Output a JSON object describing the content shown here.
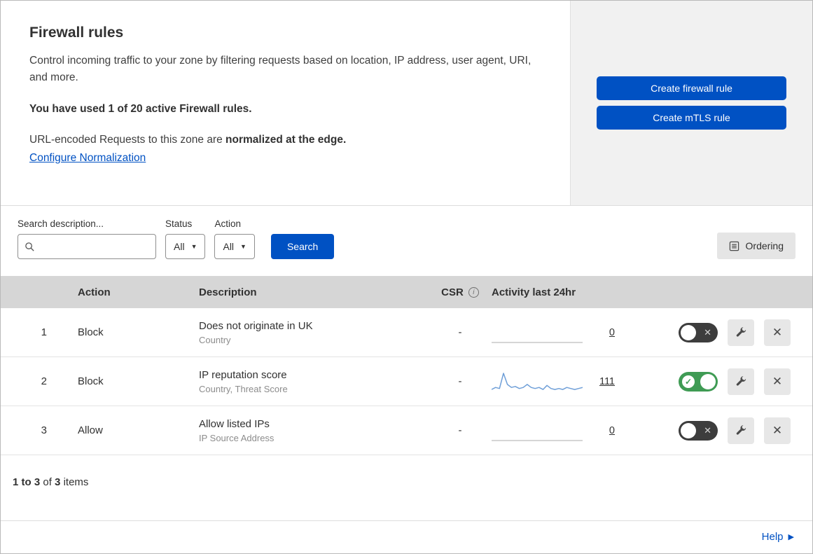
{
  "header": {
    "title": "Firewall rules",
    "description": "Control incoming traffic to your zone by filtering requests based on location, IP address, user agent, URI, and more.",
    "usage": "You have used 1 of 20 active Firewall rules.",
    "normalization_text": "URL-encoded Requests to this zone are ",
    "normalization_bold": "normalized at the edge.",
    "configure_link": "Configure Normalization",
    "buttons": {
      "create_firewall": "Create firewall rule",
      "create_mtls": "Create mTLS rule"
    }
  },
  "filters": {
    "search_label": "Search description...",
    "status_label": "Status",
    "status_value": "All",
    "action_label": "Action",
    "action_value": "All",
    "search_button": "Search",
    "ordering_button": "Ordering"
  },
  "table": {
    "columns": {
      "action": "Action",
      "description": "Description",
      "csr": "CSR",
      "activity": "Activity last 24hr"
    },
    "rows": [
      {
        "index": "1",
        "action": "Block",
        "description": "Does not originate in UK",
        "fields": "Country",
        "csr": "-",
        "activity_count": "0",
        "enabled": false,
        "spark": [
          0,
          0,
          0,
          0,
          0,
          0,
          0,
          0,
          0,
          0,
          0,
          0,
          0,
          0,
          0,
          0,
          0,
          0,
          0,
          0,
          0,
          0,
          0,
          0
        ]
      },
      {
        "index": "2",
        "action": "Block",
        "description": "IP reputation score",
        "fields": "Country, Threat Score",
        "csr": "-",
        "activity_count": "111",
        "enabled": true,
        "spark": [
          1,
          2,
          1.5,
          9,
          3.5,
          2,
          2.5,
          1.5,
          2,
          3.5,
          2,
          1.5,
          2,
          1,
          3,
          1.5,
          1,
          1.5,
          1,
          2,
          1.5,
          1,
          1.5,
          2
        ]
      },
      {
        "index": "3",
        "action": "Allow",
        "description": "Allow listed IPs",
        "fields": "IP Source Address",
        "csr": "-",
        "activity_count": "0",
        "enabled": false,
        "spark": [
          0,
          0,
          0,
          0,
          0,
          0,
          0,
          0,
          0,
          0,
          0,
          0,
          0,
          0,
          0,
          0,
          0,
          0,
          0,
          0,
          0,
          0,
          0,
          0
        ]
      }
    ],
    "footer": {
      "range": "1 to 3",
      "of_word": "of",
      "total": "3",
      "items_word": "items"
    }
  },
  "help_link": "Help",
  "colors": {
    "accent_blue": "#0051c3",
    "toggle_on_green": "#3f9b54",
    "toggle_off_gray": "#3d3d3d",
    "spark_line": "#6f9fd8",
    "spark_flat": "#c9c9c9",
    "table_header_bg": "#d6d6d6",
    "panel_bg": "#f1f1f1"
  }
}
